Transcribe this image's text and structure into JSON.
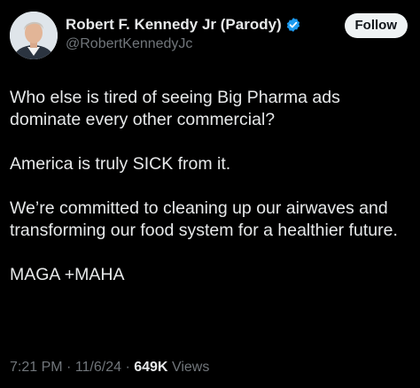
{
  "author": {
    "display_name": "Robert F. Kennedy Jr (Parody)",
    "handle": "@RobertKennedyJc",
    "verified": true,
    "avatar": "profile-photo"
  },
  "follow_button": {
    "label": "Follow"
  },
  "tweet": {
    "paragraphs": [
      "Who else is tired of seeing Big Pharma ads dominate every other commercial?",
      "America is truly SICK from it.",
      "We’re committed to cleaning up our airwaves and transforming our food system for a healthier future.",
      "MAGA +MAHA"
    ]
  },
  "meta": {
    "time": "7:21 PM",
    "separator": " · ",
    "date": "11/6/24",
    "views_count": "649K",
    "views_label": "Views"
  },
  "colors": {
    "background": "#000000",
    "text_primary": "#e7e9ea",
    "text_secondary": "#71767b",
    "verified_badge": "#1d9bf0",
    "follow_button_bg": "#eff3f4"
  }
}
